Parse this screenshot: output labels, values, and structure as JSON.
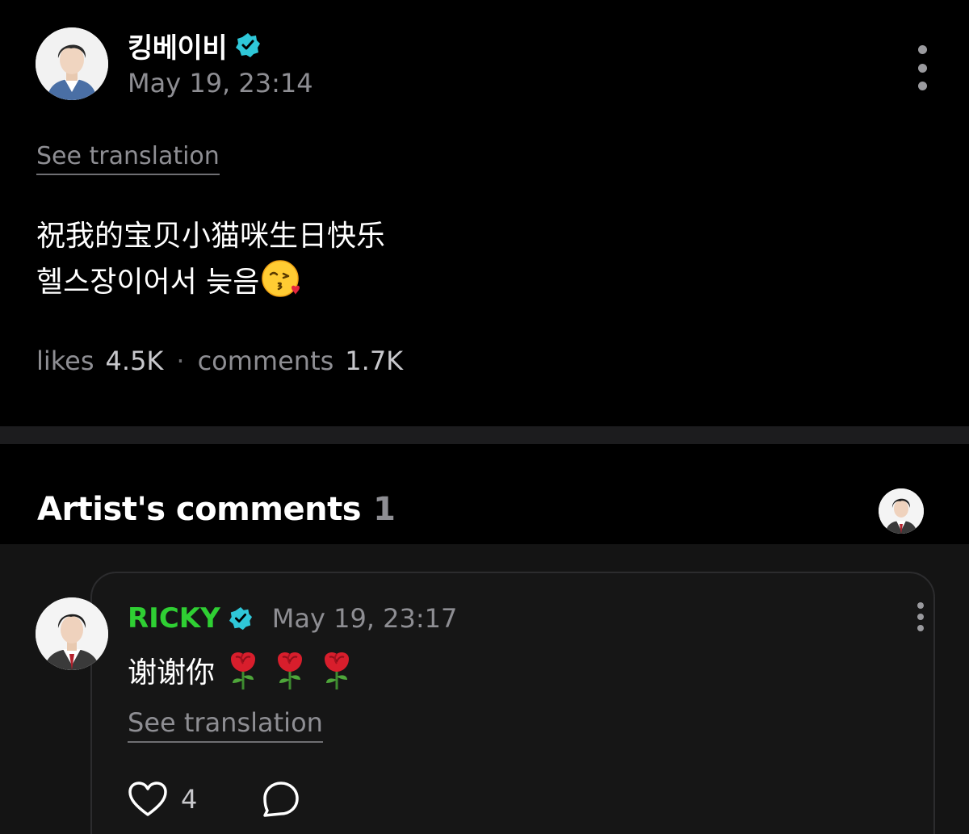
{
  "post": {
    "author": "킹베이비",
    "verified": true,
    "timestamp": "May 19, 23:14",
    "see_translation": "See translation",
    "text_line1": "祝我的宝贝小猫咪生日快乐",
    "text_line2": "헬스장이어서 늦음",
    "emoji": "kissing-face-with-heart-emoji",
    "likes_label": "likes",
    "likes_count": "4.5K",
    "separator": "·",
    "comments_label": "comments",
    "comments_count": "1.7K"
  },
  "artist_comments": {
    "title": "Artist's comments",
    "count": "1"
  },
  "comment": {
    "author": "RICKY",
    "verified": true,
    "timestamp": "May 19, 23:17",
    "text": "谢谢你",
    "emojis": [
      "rose-emoji",
      "rose-emoji",
      "rose-emoji"
    ],
    "see_translation": "See translation",
    "like_count": "4"
  },
  "colors": {
    "background": "#000000",
    "verified_badge": "#2fc7d8",
    "comment_author": "#2fcf33",
    "secondary_text": "#8e8e93",
    "divider": "#1c1c1e"
  }
}
